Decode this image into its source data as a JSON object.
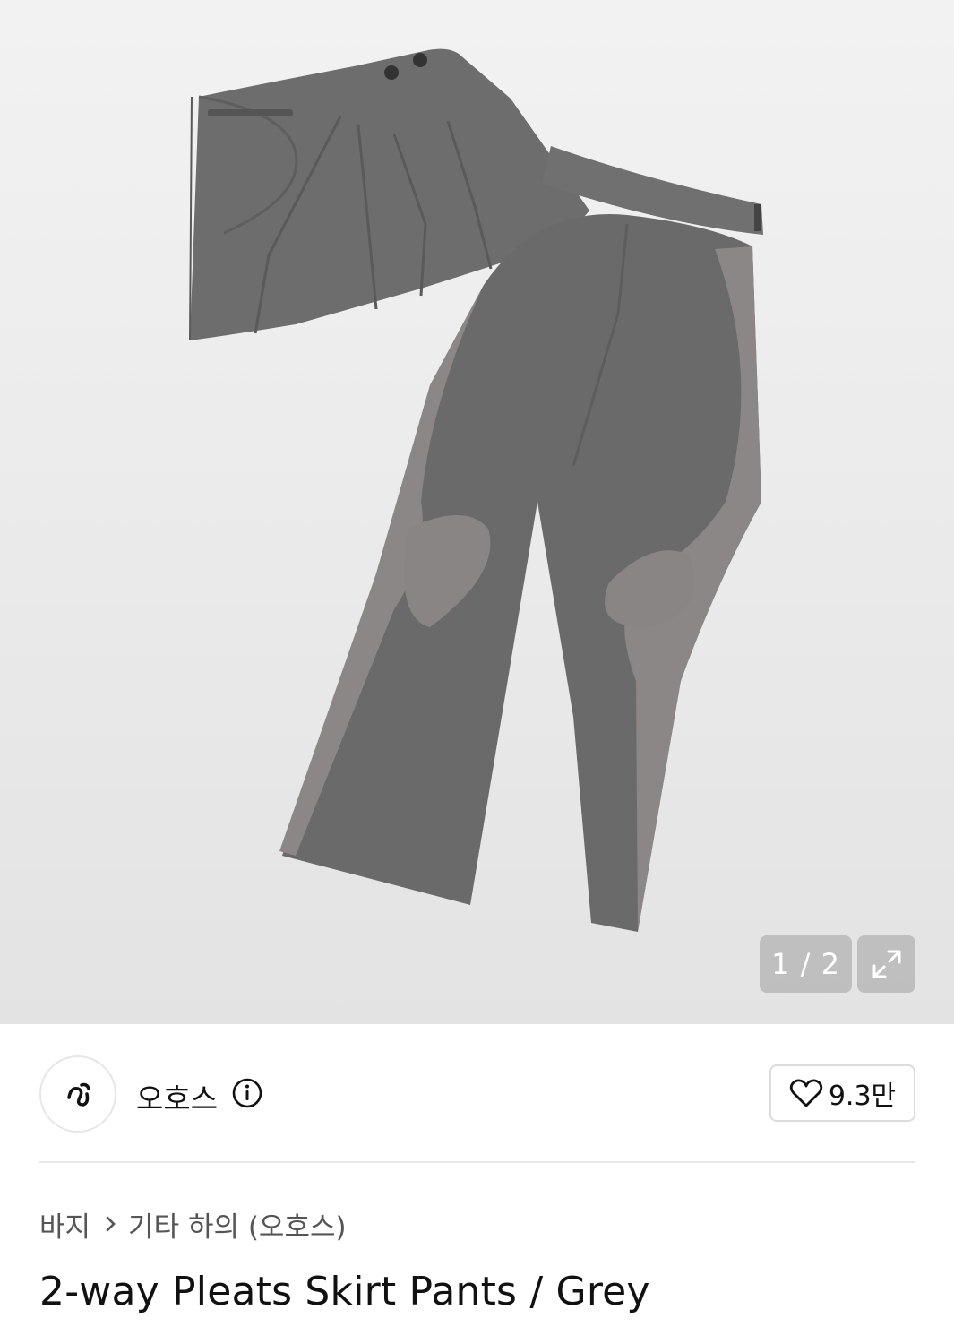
{
  "gallery": {
    "current": "1",
    "separator": "/",
    "total": "2",
    "counter_text": "1 / 2",
    "expand_icon": "expand-icon",
    "product_image_alt": "product-photo"
  },
  "brand": {
    "name": "오호스",
    "logo_icon": "brand-logo",
    "info_icon": "info-icon"
  },
  "like": {
    "icon": "heart-icon",
    "count": "9.3만"
  },
  "breadcrumb": {
    "items": [
      "바지",
      "기타 하의 (오호스)"
    ],
    "separator_icon": "chevron-right-icon"
  },
  "product": {
    "title": "2-way Pleats Skirt Pants / Grey"
  },
  "colors": {
    "garment_dark": "#6b6b6b",
    "garment_light": "#8c8787",
    "background": "#ececec"
  }
}
